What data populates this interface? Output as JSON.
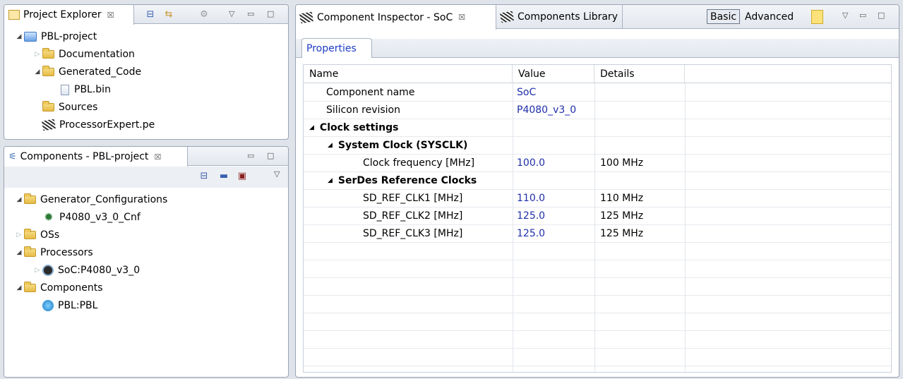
{
  "project_explorer": {
    "tab_label": "Project Explorer",
    "close_glyph": "☒",
    "tree": [
      {
        "label": "PBL-project",
        "level": 0,
        "expanded": true,
        "icon": "project-icon"
      },
      {
        "label": "Documentation",
        "level": 1,
        "expanded": false,
        "icon": "folder-icon"
      },
      {
        "label": "Generated_Code",
        "level": 1,
        "expanded": true,
        "icon": "folder-icon"
      },
      {
        "label": "PBL.bin",
        "level": 2,
        "icon": "file-icon"
      },
      {
        "label": "Sources",
        "level": 1,
        "icon": "folder-icon"
      },
      {
        "label": "ProcessorExpert.pe",
        "level": 1,
        "icon": "pe-file-icon"
      }
    ]
  },
  "components_view": {
    "tab_label": "Components - PBL-project",
    "close_glyph": "☒",
    "tree": [
      {
        "label": "Generator_Configurations",
        "level": 0,
        "expanded": true,
        "icon": "folder-icon"
      },
      {
        "label": "P4080_v3_0_Cnf",
        "level": 1,
        "icon": "gear-config-icon"
      },
      {
        "label": "OSs",
        "level": 0,
        "expanded": false,
        "icon": "folder-icon"
      },
      {
        "label": "Processors",
        "level": 0,
        "expanded": true,
        "icon": "folder-icon"
      },
      {
        "label": "SoC:P4080_v3_0",
        "level": 1,
        "expanded": false,
        "icon": "processor-chip-icon"
      },
      {
        "label": "Components",
        "level": 0,
        "expanded": true,
        "icon": "folder-icon"
      },
      {
        "label": "PBL:PBL",
        "level": 1,
        "icon": "component-icon"
      }
    ]
  },
  "inspector": {
    "tab_label": "Component Inspector - SoC",
    "close_glyph": "☒",
    "library_tab_label": "Components Library",
    "basic_label": "Basic",
    "advanced_label": "Advanced",
    "properties_tab": "Properties",
    "columns": [
      "Name",
      "Value",
      "Details"
    ],
    "rows": [
      {
        "name": "Component name",
        "value": "SoC",
        "details": "",
        "indent": 0,
        "group": false
      },
      {
        "name": "Silicon revision",
        "value": "P4080_v3_0",
        "details": "",
        "indent": 0,
        "group": false
      },
      {
        "name": "Clock settings",
        "value": "",
        "details": "",
        "indent": 0,
        "group": true
      },
      {
        "name": "System Clock (SYSCLK)",
        "value": "",
        "details": "",
        "indent": 1,
        "group": true
      },
      {
        "name": "Clock frequency [MHz]",
        "value": "100.0",
        "details": "100 MHz",
        "indent": 2,
        "group": false
      },
      {
        "name": "SerDes Reference Clocks",
        "value": "",
        "details": "",
        "indent": 1,
        "group": true
      },
      {
        "name": "SD_REF_CLK1 [MHz]",
        "value": "110.0",
        "details": "110 MHz",
        "indent": 2,
        "group": false
      },
      {
        "name": "SD_REF_CLK2 [MHz]",
        "value": "125.0",
        "details": "125 MHz",
        "indent": 2,
        "group": false
      },
      {
        "name": "SD_REF_CLK3 [MHz]",
        "value": "125.0",
        "details": "125 MHz",
        "indent": 2,
        "group": false
      }
    ]
  }
}
